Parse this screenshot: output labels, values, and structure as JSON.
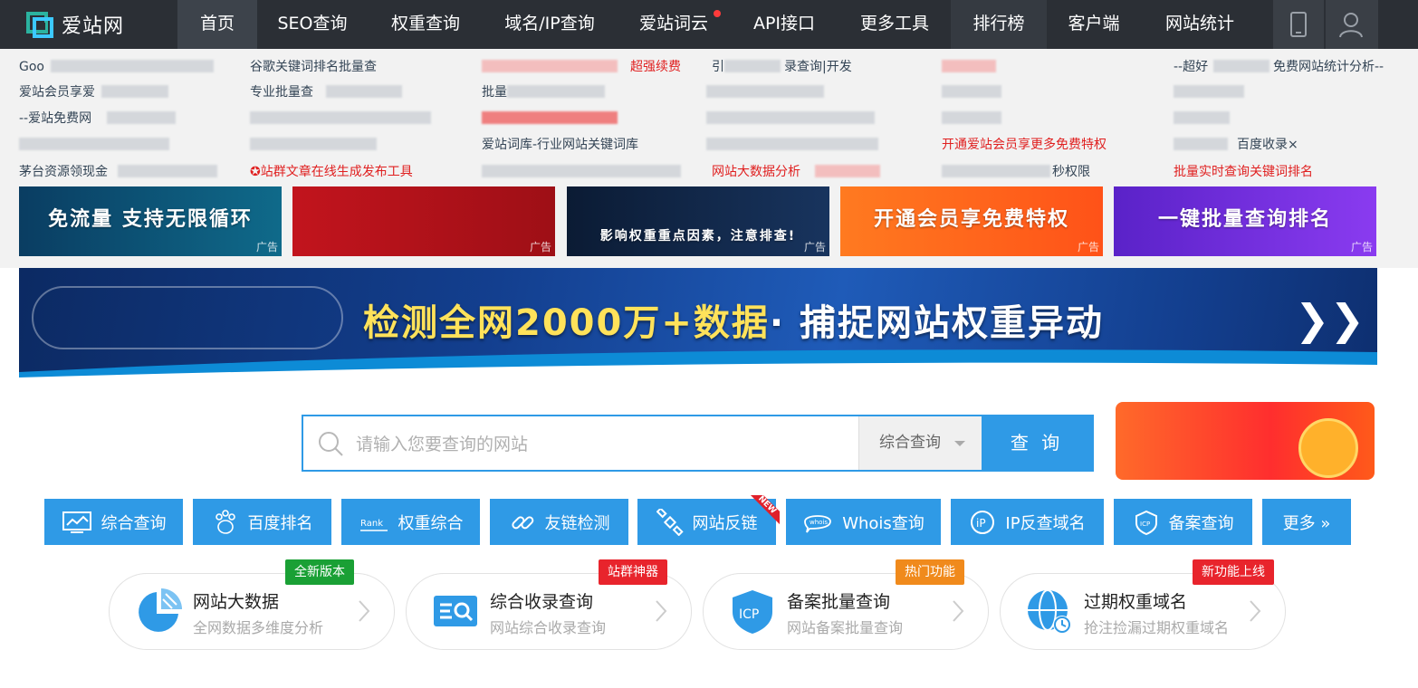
{
  "app": {
    "logo_text": "爱站网"
  },
  "nav": {
    "items": [
      {
        "label": "首页"
      },
      {
        "label": "SEO查询"
      },
      {
        "label": "权重查询"
      },
      {
        "label": "域名/IP查询"
      },
      {
        "label": "爱站词云"
      },
      {
        "label": "API接口"
      },
      {
        "label": "更多工具"
      },
      {
        "label": "排行榜"
      },
      {
        "label": "客户端"
      },
      {
        "label": "网站统计"
      }
    ]
  },
  "links": {
    "col1": [
      "Goo",
      "爱站会员享爱",
      "--爱站免费网",
      "",
      "茅台资源领现金"
    ],
    "col2": [
      "谷歌关键词排名批量查",
      "专业批量查",
      "",
      "",
      "站群文章在线生成发布工具"
    ],
    "col3": [
      "",
      "批量",
      "",
      "爱站词库-行业网站关键词库",
      ""
    ],
    "col3_red": "超强续费",
    "col4": [
      "引",
      "",
      "",
      "",
      "网站大数据分析"
    ],
    "col4_tail": "录查询|开发",
    "col5": [
      "",
      "",
      "",
      "开通爱站会员享更多免费特权",
      "秒权限"
    ],
    "col6": [
      "--超好",
      "",
      "",
      "",
      "批量实时查询关键词排名"
    ],
    "col6_tail": "免费网站统计分析--",
    "col6_row4": "百度收录×",
    "ad_label": "广告"
  },
  "ads": [
    {
      "text": "免流量 支持无限循环",
      "color": "#0b4a6a"
    },
    {
      "text": "",
      "color": "#b3121a"
    },
    {
      "text": "影响权重重点因素，注意排查!",
      "color": "#0d2344"
    },
    {
      "text": "开通会员享免费特权",
      "color": "#ff6a1a"
    },
    {
      "text": "一键批量查询排名",
      "color": "#6a2bd6"
    }
  ],
  "banner": {
    "text_yellow": "检测全网2000万+数据",
    "text_white": "· 捕捉网站权重异动"
  },
  "search": {
    "placeholder": "请输入您要查询的网站",
    "select_value": "综合查询",
    "button": "查 询"
  },
  "tools": [
    {
      "label": "综合查询"
    },
    {
      "label": "百度排名"
    },
    {
      "label": "权重综合"
    },
    {
      "label": "友链检测"
    },
    {
      "label": "网站反链"
    },
    {
      "label": "Whois查询"
    },
    {
      "label": "IP反查域名"
    },
    {
      "label": "备案查询"
    },
    {
      "label": "更多 »"
    }
  ],
  "new_flag": "NEW",
  "cards": [
    {
      "title": "网站大数据",
      "sub": "全网数据多维度分析",
      "tag": "全新版本",
      "tag_color": "#1aa035"
    },
    {
      "title": "综合收录查询",
      "sub": "网站综合收录查询",
      "tag": "站群神器",
      "tag_color": "#e8242c"
    },
    {
      "title": "备案批量查询",
      "sub": "网站备案批量查询",
      "tag": "热门功能",
      "tag_color": "#f08a1c"
    },
    {
      "title": "过期权重域名",
      "sub": "抢注捡漏过期权重域名",
      "tag": "新功能上线",
      "tag_color": "#e8242c"
    }
  ]
}
